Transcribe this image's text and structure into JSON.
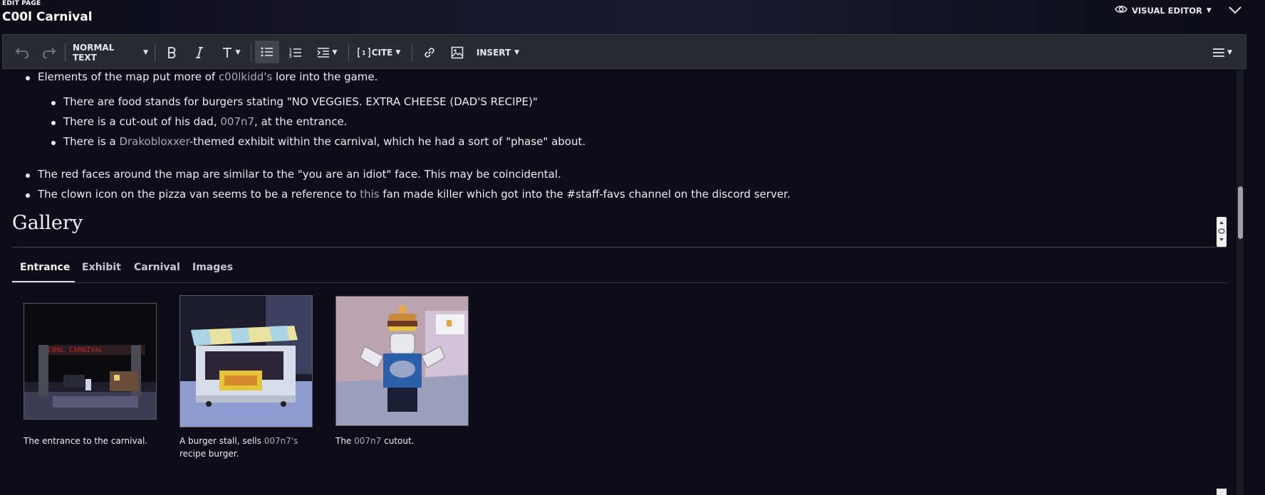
{
  "header": {
    "edit_label": "EDIT PAGE",
    "title": "C00l Carnival",
    "editor_mode": "VISUAL EDITOR"
  },
  "toolbar": {
    "format": "NORMAL TEXT",
    "cite": "CITE",
    "insert": "INSERT"
  },
  "bullets": [
    {
      "before": "Elements of the map put more of ",
      "link": "c00lkidd's",
      "after": " lore into the game.",
      "children": [
        {
          "before": "There are food stands for burgers stating \"NO VEGGIES. EXTRA CHEESE (DAD'S RECIPE)\"",
          "link": "",
          "after": ""
        },
        {
          "before": "There is a cut-out of his dad, ",
          "link": "007n7",
          "after": ", at the entrance."
        },
        {
          "before": "There is a ",
          "link": "Drakobloxxer",
          "after": "-themed exhibit within the carnival, which he had a sort of \"phase\" about."
        }
      ]
    },
    {
      "before": "The red faces around the map are similar to the \"you are an idiot\" face. This may be coincidental.",
      "link": "",
      "after": ""
    },
    {
      "before": "The clown icon on the pizza van seems to be a reference to ",
      "link": "this",
      "after": " fan made killer which got into the #staff-favs channel on the discord server."
    }
  ],
  "gallery": {
    "heading": "Gallery",
    "tabs": [
      "Entrance",
      "Exhibit",
      "Carnival",
      "Images"
    ],
    "active_tab": "Entrance",
    "items": [
      {
        "caption_before": "The entrance to the carnival.",
        "caption_link": "",
        "caption_after": "",
        "sign_text": "C00L CARNIVAL"
      },
      {
        "caption_before": "A burger stall, sells ",
        "caption_link": "007n7's",
        "caption_after": "recipe burger."
      },
      {
        "caption_before": "The ",
        "caption_link": "007n7",
        "caption_after": " cutout."
      }
    ]
  },
  "colors": {
    "background": "#0e0d17",
    "toolbar": "#2a2a31",
    "link": "#a7a7b5"
  }
}
